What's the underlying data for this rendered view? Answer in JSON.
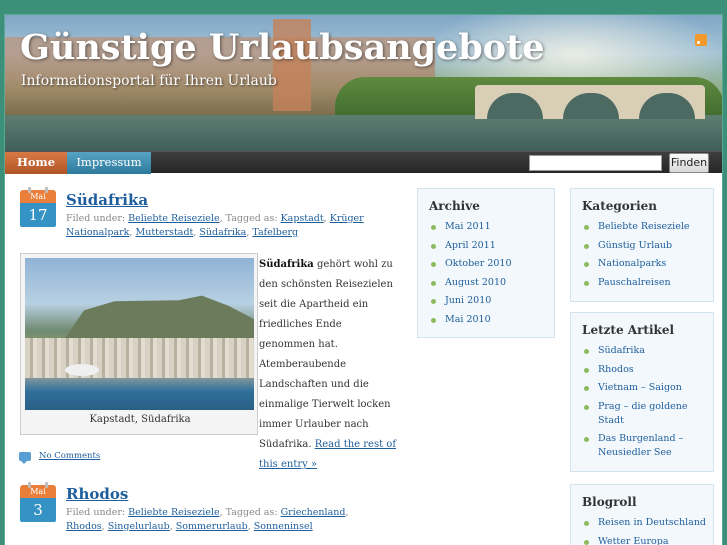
{
  "header": {
    "title": "Günstige Urlaubsangebote",
    "tagline": "Informationsportal für Ihren Urlaub",
    "rss_icon": "rss-icon"
  },
  "nav": {
    "tabs": [
      {
        "label": "Home",
        "active": true
      },
      {
        "label": "Impressum",
        "active": false
      }
    ],
    "search": {
      "value": "",
      "button": "Finden"
    }
  },
  "colors": {
    "accent_orange": "#e97f3b",
    "accent_blue": "#3493c4",
    "link": "#1f5e9c",
    "background": "#3c8f78"
  },
  "posts": [
    {
      "month": "Mai",
      "day": "17",
      "title": "Südafrika",
      "filed_prefix": "Filed under:",
      "categories": [
        "Beliebte Reiseziele"
      ],
      "tagged_prefix": "Tagged as:",
      "tags": [
        "Kapstadt",
        "Krüger Nationalpark",
        "Mutterstadt",
        "Südafrika",
        "Tafelberg"
      ],
      "image_caption": "Kapstadt, Südafrika",
      "excerpt_bold": "Südafrika",
      "excerpt": "gehört wohl zu den schönsten Reisezielen seit die Apartheid ein friedliches Ende genommen hat. Atemberaubende Landschaften und die einmalige Tierwelt locken immer Urlauber nach Südafrika.",
      "read_more": "Read the rest of this entry »",
      "comments": "No Comments"
    },
    {
      "month": "Mai",
      "day": "3",
      "title": "Rhodos",
      "filed_prefix": "Filed under:",
      "categories": [
        "Beliebte Reiseziele"
      ],
      "tagged_prefix": "Tagged as:",
      "tags": [
        "Griechenland",
        "Rhodos",
        "Singelurlaub",
        "Sommerurlaub",
        "Sonneninsel"
      ]
    }
  ],
  "sidebar": {
    "archive": {
      "title": "Archive",
      "items": [
        "Mai 2011",
        "April 2011",
        "Oktober 2010",
        "August 2010",
        "Juni 2010",
        "Mai 2010"
      ]
    },
    "categories": {
      "title": "Kategorien",
      "items": [
        "Beliebte Reiseziele",
        "Günstig Urlaub",
        "Nationalparks",
        "Pauschalreisen"
      ]
    },
    "recent": {
      "title": "Letzte Artikel",
      "items": [
        "Südafrika",
        "Rhodos",
        "Vietnam – Saigon",
        "Prag – die goldene Stadt",
        "Das Burgenland – Neusiedler See"
      ]
    },
    "blogroll": {
      "title": "Blogroll",
      "items": [
        "Reisen in Deutschland",
        "Wetter Europa"
      ]
    }
  }
}
